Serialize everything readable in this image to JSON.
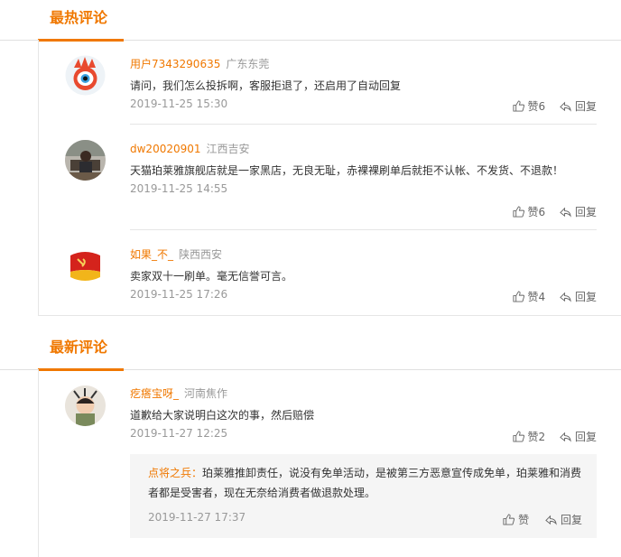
{
  "hot": {
    "title": "最热评论",
    "comments": [
      {
        "user": "用户7343290635",
        "location": "广东东莞",
        "text": "请问，我们怎么投拆啊，客服拒退了，还启用了自动回复",
        "time": "2019-11-25 15:30",
        "like_label": "赞6",
        "reply_label": "回复",
        "avatar": "weibo-eye-avatar"
      },
      {
        "user": "dw20020901",
        "location": "江西吉安",
        "text": "天猫珀莱雅旗舰店就是一家黑店，无良无耻，赤裸裸刷单后就拒不认帐、不发货、不退款！",
        "time": "2019-11-25 14:55",
        "like_label": "赞6",
        "reply_label": "回复",
        "avatar": "photo-avatar"
      },
      {
        "user": "如果_不_",
        "location": "陕西西安",
        "text": "卖家双十一刷单。毫无信誉可言。",
        "time": "2019-11-25 17:26",
        "like_label": "赞4",
        "reply_label": "回复",
        "avatar": "party-badge-avatar"
      }
    ]
  },
  "latest": {
    "title": "最新评论",
    "comments": [
      {
        "user": "疙瘩宝呀_",
        "location": "河南焦作",
        "text": "道歉给大家说明白这次的事，然后赔偿",
        "time": "2019-11-27 12:25",
        "like_label": "赞2",
        "reply_label": "回复",
        "avatar": "child-photo-avatar"
      }
    ],
    "reply": {
      "user": "点将之兵",
      "sep": "：",
      "text": "珀莱雅推卸责任，说没有免单活动，是被第三方恶意宣传成免单，珀莱雅和消费者都是受害者，现在无奈给消费者做退款处理。",
      "time": "2019-11-27 17:37",
      "like_label": "赞",
      "reply_label": "回复"
    }
  },
  "colors": {
    "accent": "#f07800",
    "muted": "#999999",
    "text": "#333333"
  }
}
